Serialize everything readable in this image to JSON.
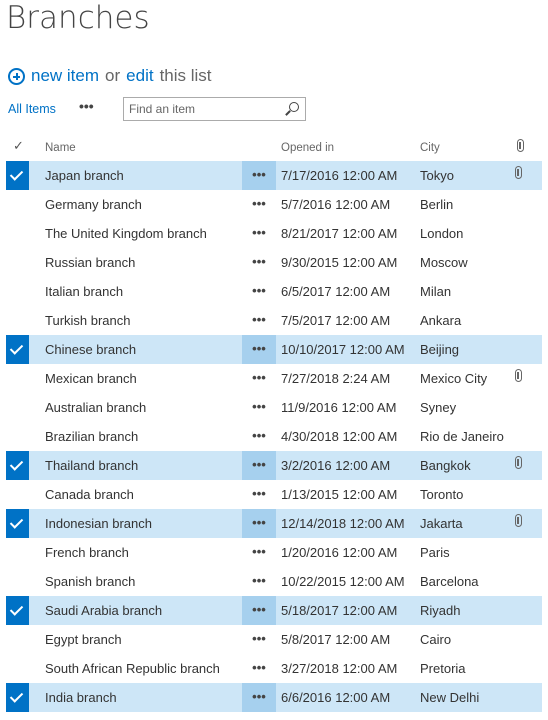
{
  "page": {
    "title": "Branches",
    "new_item": "new item",
    "or": "or",
    "edit": "edit",
    "this_list": "this list"
  },
  "toolbar": {
    "view": "All Items",
    "more": "•••",
    "search_placeholder": "Find an item"
  },
  "columns": {
    "check": "✓",
    "name": "Name",
    "opened": "Opened in",
    "city": "City",
    "attachments_icon": "paperclip-icon"
  },
  "rows": [
    {
      "name": "Japan branch",
      "opened": "7/17/2016 12:00 AM",
      "city": "Tokyo",
      "selected": true,
      "attachment": true
    },
    {
      "name": "Germany branch",
      "opened": "5/7/2016 12:00 AM",
      "city": "Berlin",
      "selected": false,
      "attachment": false
    },
    {
      "name": "The United Kingdom branch",
      "opened": "8/21/2017 12:00 AM",
      "city": "London",
      "selected": false,
      "attachment": false
    },
    {
      "name": "Russian branch",
      "opened": "9/30/2015 12:00 AM",
      "city": "Moscow",
      "selected": false,
      "attachment": false
    },
    {
      "name": "Italian branch",
      "opened": "6/5/2017 12:00 AM",
      "city": "Milan",
      "selected": false,
      "attachment": false
    },
    {
      "name": "Turkish branch",
      "opened": "7/5/2017 12:00 AM",
      "city": "Ankara",
      "selected": false,
      "attachment": false
    },
    {
      "name": "Chinese branch",
      "opened": "10/10/2017 12:00 AM",
      "city": "Beijing",
      "selected": true,
      "attachment": false
    },
    {
      "name": "Mexican branch",
      "opened": "7/27/2018 2:24 AM",
      "city": "Mexico City",
      "selected": false,
      "attachment": true
    },
    {
      "name": "Australian branch",
      "opened": "11/9/2016 12:00 AM",
      "city": "Syney",
      "selected": false,
      "attachment": false
    },
    {
      "name": "Brazilian branch",
      "opened": "4/30/2018 12:00 AM",
      "city": "Rio de Janeiro",
      "selected": false,
      "attachment": false
    },
    {
      "name": "Thailand branch",
      "opened": "3/2/2016 12:00 AM",
      "city": "Bangkok",
      "selected": true,
      "attachment": true
    },
    {
      "name": "Canada branch",
      "opened": "1/13/2015 12:00 AM",
      "city": "Toronto",
      "selected": false,
      "attachment": false
    },
    {
      "name": "Indonesian branch",
      "opened": "12/14/2018 12:00 AM",
      "city": "Jakarta",
      "selected": true,
      "attachment": true
    },
    {
      "name": "French branch",
      "opened": "1/20/2016 12:00 AM",
      "city": "Paris",
      "selected": false,
      "attachment": false
    },
    {
      "name": "Spanish branch",
      "opened": "10/22/2015 12:00 AM",
      "city": "Barcelona",
      "selected": false,
      "attachment": false
    },
    {
      "name": "Saudi Arabia branch",
      "opened": "5/18/2017 12:00 AM",
      "city": "Riyadh",
      "selected": true,
      "attachment": false
    },
    {
      "name": "Egypt branch",
      "opened": "5/8/2017 12:00 AM",
      "city": "Cairo",
      "selected": false,
      "attachment": false
    },
    {
      "name": "South African Republic branch",
      "opened": "3/27/2018 12:00 AM",
      "city": "Pretoria",
      "selected": false,
      "attachment": false
    },
    {
      "name": "India branch",
      "opened": "6/6/2016 12:00 AM",
      "city": "New Delhi",
      "selected": true,
      "attachment": false
    }
  ],
  "row_menu": "•••"
}
